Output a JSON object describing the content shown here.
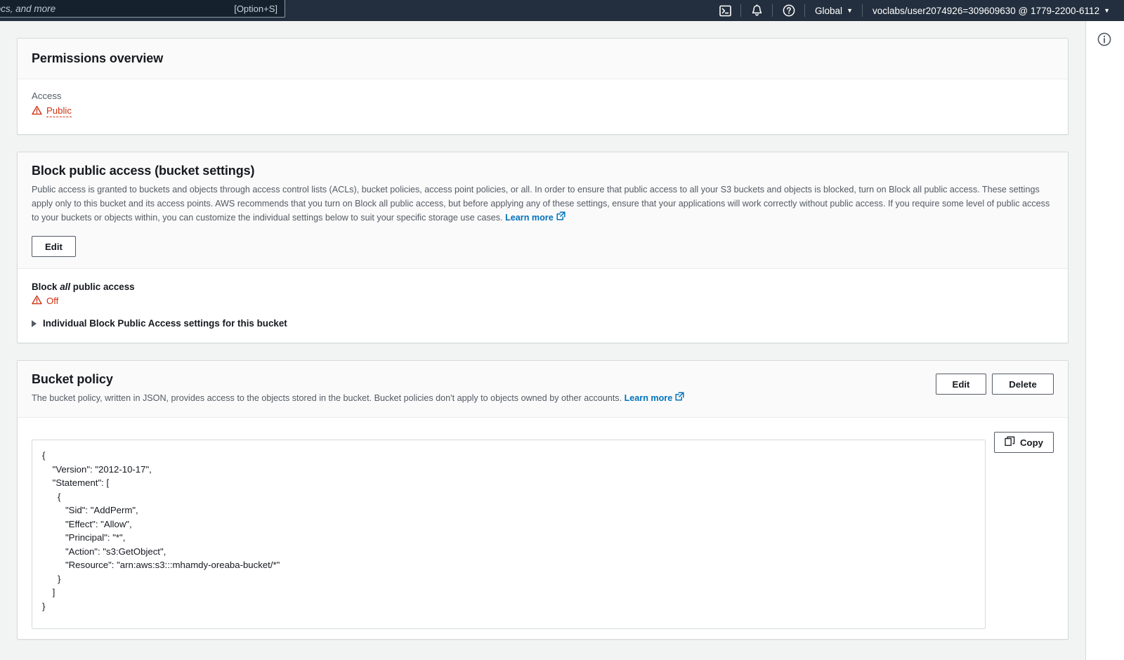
{
  "topnav": {
    "search": {
      "placeholder": "Search for services, features, blogs, docs, and more",
      "shortcut": "[Option+S]"
    },
    "cloudshell_icon": "cloudshell-terminal-icon",
    "notifications_icon": "bell-notifications-icon",
    "help_icon": "question-mark-help-icon",
    "region_label": "Global",
    "account_label": "voclabs/user2074926=309609630 @ 1779-2200-6112",
    "caret": "▼"
  },
  "right_panel": {
    "info_icon": "info-circle-icon"
  },
  "permissions_overview": {
    "title": "Permissions overview",
    "access_label": "Access",
    "access_value": "Public",
    "warning_icon": "warning-triangle-icon",
    "warning_color": "#d13212"
  },
  "block_public_access": {
    "title": "Block public access (bucket settings)",
    "description": "Public access is granted to buckets and objects through access control lists (ACLs), bucket policies, access point policies, or all. In order to ensure that public access to all your S3 buckets and objects is blocked, turn on Block all public access. These settings apply only to this bucket and its access points. AWS recommends that you turn on Block all public access, but before applying any of these settings, ensure that your applications will work correctly without public access. If you require some level of public access to your buckets or objects within, you can customize the individual settings below to suit your specific storage use cases.",
    "learn_more": "Learn more",
    "external_link_icon": "external-link-icon",
    "edit_button": "Edit",
    "block_all_prefix": "Block ",
    "block_all_emphasis": "all",
    "block_all_suffix": " public access",
    "block_all_status": "Off",
    "warning_icon": "warning-triangle-icon",
    "expander_label": "Individual Block Public Access settings for this bucket",
    "expander_icon": "triangle-right-icon"
  },
  "bucket_policy": {
    "title": "Bucket policy",
    "description": "The bucket policy, written in JSON, provides access to the objects stored in the bucket. Bucket policies don't apply to objects owned by other accounts.",
    "learn_more": "Learn more",
    "external_link_icon": "external-link-icon",
    "edit_button": "Edit",
    "delete_button": "Delete",
    "copy_button": "Copy",
    "copy_icon": "copy-icon",
    "policy_json": "{\n    \"Version\": \"2012-10-17\",\n    \"Statement\": [\n      {\n         \"Sid\": \"AddPerm\",\n         \"Effect\": \"Allow\",\n         \"Principal\": \"*\",\n         \"Action\": \"s3:GetObject\",\n         \"Resource\": \"arn:aws:s3:::mhamdy-oreaba-bucket/*\"\n      }\n    ]\n}"
  }
}
